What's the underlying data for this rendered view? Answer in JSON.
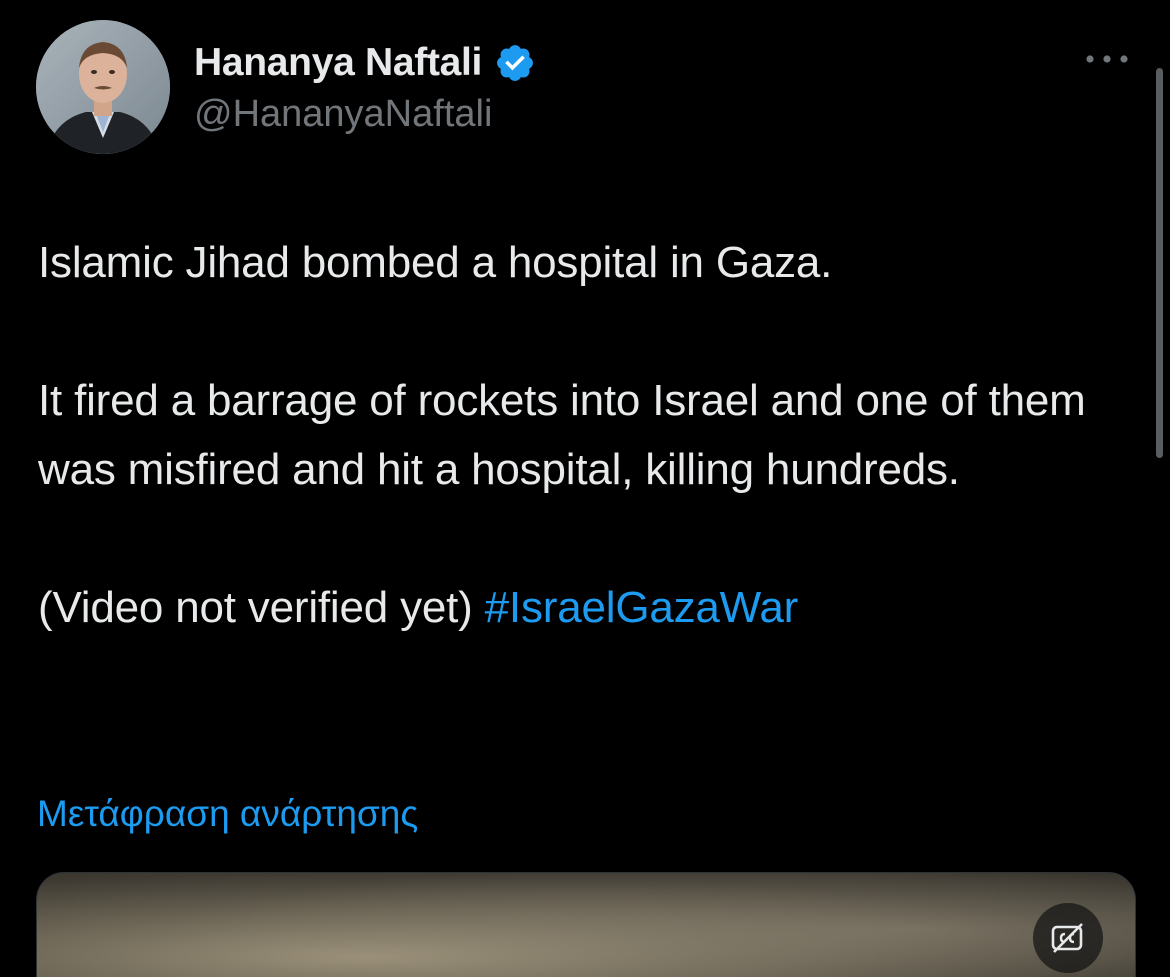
{
  "author": {
    "display_name": "Hananya Naftali",
    "handle": "@HananyaNaftali",
    "verified": true
  },
  "tweet": {
    "line1": "Islamic Jihad bombed a hospital in Gaza.",
    "line2": "It fired a barrage of rockets into Israel and one of them was misfired and hit a hospital, killing hundreds.",
    "line3_text": "(Video not verified yet) ",
    "hashtag": "#IsraelGazaWar"
  },
  "translate_label": "Μετάφραση ανάρτησης",
  "icons": {
    "verified": "verified-badge-icon",
    "more": "more-options-icon",
    "captions": "captions-toggle-icon"
  },
  "colors": {
    "background": "#000000",
    "text": "#e7e9ea",
    "secondary_text": "#71767b",
    "link": "#1d9bf0"
  }
}
